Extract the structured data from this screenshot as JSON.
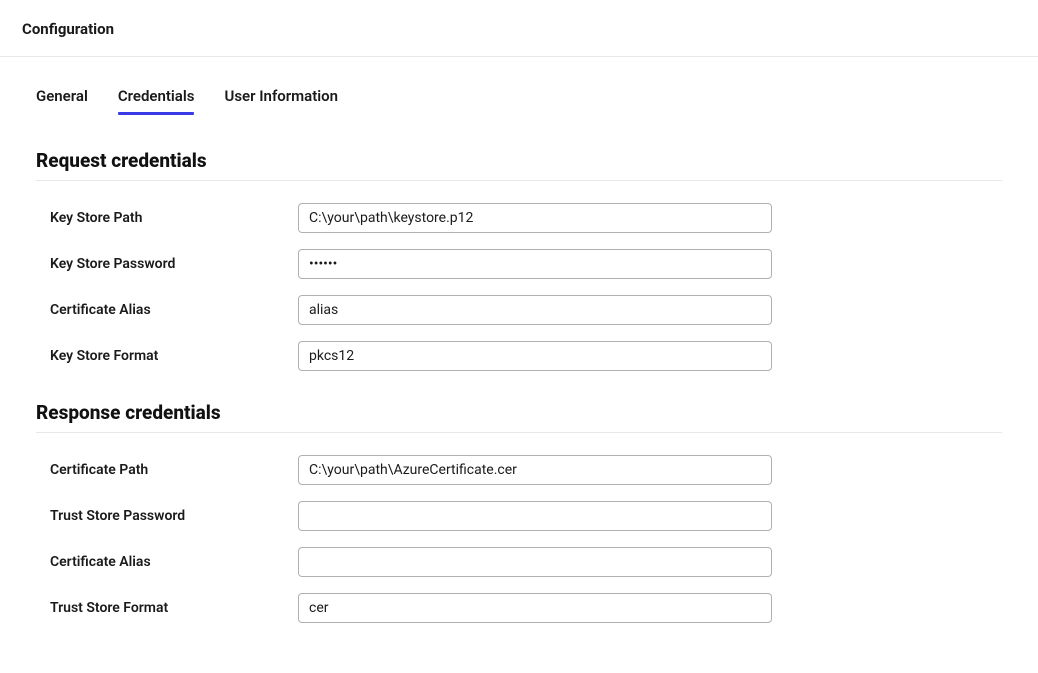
{
  "header": {
    "title": "Configuration"
  },
  "tabs": {
    "general": "General",
    "credentials": "Credentials",
    "user_information": "User Information",
    "active": "credentials"
  },
  "sections": {
    "request": {
      "title": "Request credentials",
      "fields": {
        "key_store_path": {
          "label": "Key Store Path",
          "value": "C:\\your\\path\\keystore.p12"
        },
        "key_store_password": {
          "label": "Key Store Password",
          "value": "••••••"
        },
        "certificate_alias": {
          "label": "Certificate Alias",
          "value": "alias"
        },
        "key_store_format": {
          "label": "Key Store Format",
          "value": "pkcs12"
        }
      }
    },
    "response": {
      "title": "Response credentials",
      "fields": {
        "certificate_path": {
          "label": "Certificate Path",
          "value": "C:\\your\\path\\AzureCertificate.cer"
        },
        "trust_store_password": {
          "label": "Trust Store Password",
          "value": ""
        },
        "certificate_alias": {
          "label": "Certificate Alias",
          "value": ""
        },
        "trust_store_format": {
          "label": "Trust Store Format",
          "value": "cer"
        }
      }
    }
  }
}
